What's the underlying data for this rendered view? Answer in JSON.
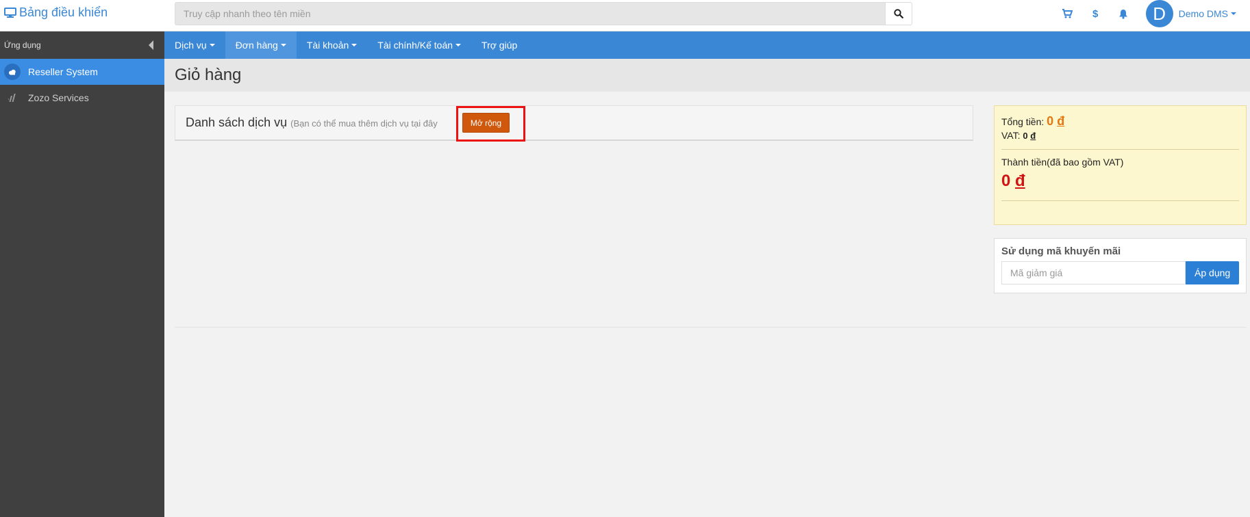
{
  "brand": {
    "title": "Bảng điều khiển",
    "icon": "monitor-icon"
  },
  "search": {
    "placeholder": "Truy cập nhanh theo tên miền",
    "value": ""
  },
  "top_icons": {
    "cart_icon": "cart-icon",
    "dollar_label": "$",
    "bell_icon": "bell-icon"
  },
  "user": {
    "avatar_letter": "D",
    "name": "Demo DMS"
  },
  "sidebar": {
    "header": "Ứng dụng",
    "items": [
      {
        "label": "Reseller System",
        "icon": "cloud-icon",
        "active": true
      },
      {
        "label": "Zozo Services",
        "icon": "bars-icon",
        "active": false
      }
    ]
  },
  "nav": {
    "items": [
      {
        "label": "Dịch vụ",
        "dropdown": true
      },
      {
        "label": "Đơn hàng",
        "dropdown": true
      },
      {
        "label": "Tài khoản",
        "dropdown": true
      },
      {
        "label": "Tài chính/Kế toán",
        "dropdown": true
      },
      {
        "label": "Trợ giúp",
        "dropdown": false
      }
    ]
  },
  "page": {
    "title": "Giỏ hàng"
  },
  "services": {
    "title": "Danh sách dịch vụ",
    "note": "(Bạn có thể mua thêm dịch vụ tại đây",
    "expand_label": "Mở rộng"
  },
  "summary": {
    "total_label": "Tổng tiền:",
    "total_value": "0",
    "vat_label": "VAT:",
    "vat_value": "0",
    "final_label": "Thành tiền(đã bao gồm VAT)",
    "final_value": "0",
    "currency": "đ"
  },
  "promo": {
    "title": "Sử dụng mã khuyến mãi",
    "placeholder": "Mã giảm giá",
    "apply_label": "Áp dụng"
  },
  "colors": {
    "accent": "#3a87d6",
    "expand": "#d0580c",
    "highlight": "#ee1111",
    "total": "#e6760f",
    "final": "#d21414"
  }
}
